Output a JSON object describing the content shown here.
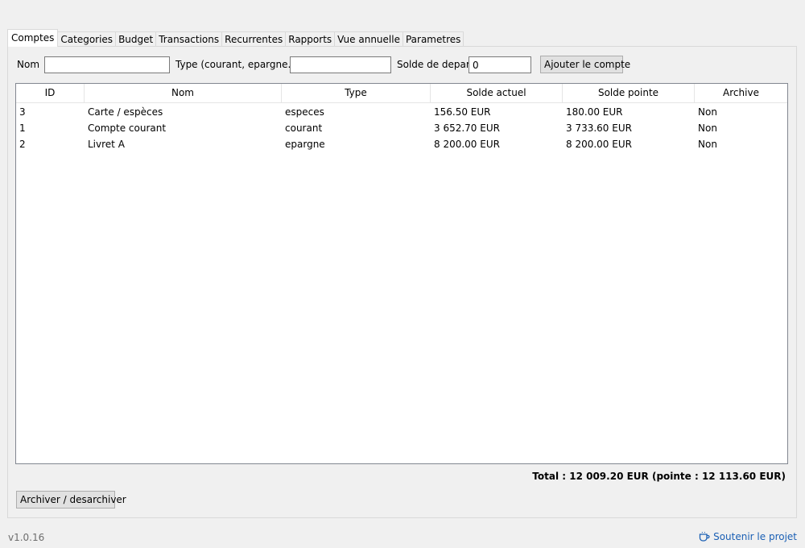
{
  "tabs": [
    {
      "label": "Comptes",
      "active": true
    },
    {
      "label": "Categories"
    },
    {
      "label": "Budget"
    },
    {
      "label": "Transactions"
    },
    {
      "label": "Recurrentes"
    },
    {
      "label": "Rapports"
    },
    {
      "label": "Vue annuelle"
    },
    {
      "label": "Parametres"
    }
  ],
  "form": {
    "name_label": "Nom",
    "name_value": "",
    "type_label": "Type (courant, epargne...)",
    "type_value": "",
    "balance_label": "Solde de depart",
    "balance_value": "0",
    "add_button": "Ajouter le compte"
  },
  "table": {
    "columns": [
      "ID",
      "Nom",
      "Type",
      "Solde actuel",
      "Solde pointe",
      "Archive"
    ],
    "rows": [
      [
        "3",
        "Carte / espèces",
        "especes",
        "156.50 EUR",
        "180.00 EUR",
        "Non"
      ],
      [
        "1",
        "Compte courant",
        "courant",
        "3 652.70 EUR",
        "3 733.60 EUR",
        "Non"
      ],
      [
        "2",
        "Livret A",
        "epargne",
        "8 200.00 EUR",
        "8 200.00 EUR",
        "Non"
      ]
    ]
  },
  "total_text": "Total : 12 009.20 EUR (pointe : 12 113.60 EUR)",
  "archive_button": "Archiver / desarchiver",
  "footer": {
    "version": "v1.0.16",
    "support_link": "Soutenir le projet",
    "support_icon": "coffee-cup-icon",
    "link_color": "#1a5fb4"
  }
}
